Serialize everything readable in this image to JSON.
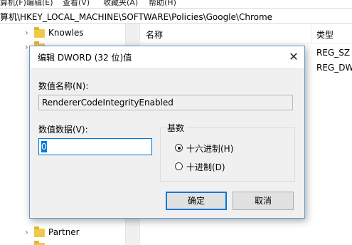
{
  "menu": [
    "算机(F)",
    "编辑(E)",
    "查看(V)",
    "收藏夹(A)",
    "帮助(H)"
  ],
  "address": "算机\\HKEY_LOCAL_MACHINE\\SOFTWARE\\Policies\\Google\\Chrome",
  "tree": {
    "items": [
      {
        "label": "Knowles",
        "chevron": "›"
      },
      {
        "label": "Partner",
        "chevron": "›"
      }
    ]
  },
  "values_panel": {
    "col_name": "名称",
    "col_type": "类型",
    "types": [
      "REG_SZ",
      "REG_DW"
    ]
  },
  "dialog": {
    "title": "编辑 DWORD (32 位)值",
    "close_glyph": "✕",
    "value_name_label": "数值名称(N):",
    "value_name": "RendererCodeIntegrityEnabled",
    "value_data_label": "数值数据(V):",
    "value_data": "0",
    "base_label": "基数",
    "radio_hex": "十六进制(H)",
    "radio_dec": "十进制(D)",
    "ok_label": "确定",
    "cancel_label": "取消"
  }
}
